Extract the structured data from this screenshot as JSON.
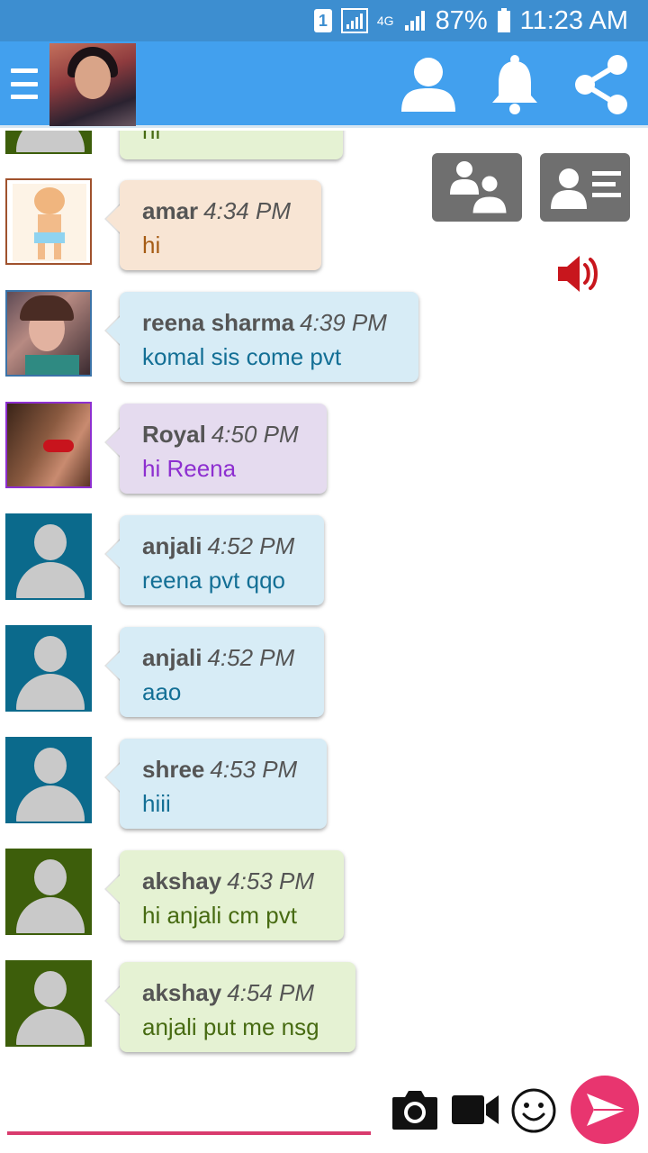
{
  "status_bar": {
    "sim_badge": "1",
    "network_type": "4G",
    "battery": "87%",
    "time": "11:23 AM"
  },
  "header": {
    "menu_icon": "hamburger-menu-icon",
    "actions": [
      "profile-icon",
      "notification-bell-icon",
      "share-icon"
    ]
  },
  "side_actions": [
    "users-icon",
    "user-card-icon",
    "speaker-icon"
  ],
  "messages": [
    {
      "name": "amar",
      "time": "4:34 PM",
      "text": "hi",
      "theme": "peach"
    },
    {
      "name": "reena sharma",
      "time": "4:39 PM",
      "text": "komal sis come pvt",
      "theme": "blue"
    },
    {
      "name": "Royal",
      "time": "4:50 PM",
      "text": "hi Reena",
      "theme": "purple"
    },
    {
      "name": "anjali",
      "time": "4:52 PM",
      "text": "reena pvt qqo",
      "theme": "blue"
    },
    {
      "name": "anjali",
      "time": "4:52 PM",
      "text": "aao",
      "theme": "blue"
    },
    {
      "name": "shree",
      "time": "4:53 PM",
      "text": "hiii",
      "theme": "blue"
    },
    {
      "name": "akshay",
      "time": "4:53 PM",
      "text": "hi anjali cm pvt",
      "theme": "green"
    },
    {
      "name": "akshay",
      "time": "4:54 PM",
      "text": "anjali put me nsg",
      "theme": "green"
    }
  ],
  "partial_message": {
    "text": "hi",
    "theme": "green"
  },
  "composer": {
    "placeholder": "",
    "icons": [
      "camera-icon",
      "video-camera-icon",
      "emoji-icon",
      "send-icon"
    ]
  },
  "colors": {
    "status_bar": "#3d8ed0",
    "app_bar": "#42a0ee",
    "send_button": "#e8356f",
    "input_underline": "#d93b6e",
    "speaker": "#c8161d"
  }
}
